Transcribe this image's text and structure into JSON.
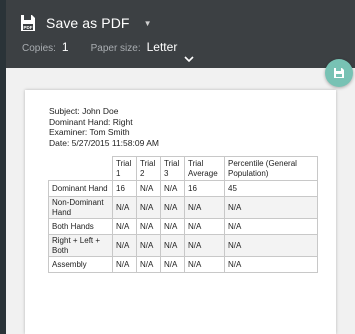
{
  "destination": {
    "label": "Save as PDF",
    "icon": "pdf-save-icon"
  },
  "options": {
    "copies_label": "Copies:",
    "copies_value": "1",
    "paper_size_label": "Paper size:",
    "paper_size_value": "Letter"
  },
  "fab": {
    "icon": "save-icon",
    "color": "#78c2b4"
  },
  "colors": {
    "toolbar": "#3c4043",
    "page_bg": "#f1f1f1"
  },
  "document": {
    "subject": "Subject: John Doe",
    "dominant_hand": "Dominant Hand: Right",
    "examiner": "Examiner: Tom Smith",
    "date": "Date: 5/27/2015 11:58:09 AM",
    "table": {
      "headers": [
        "",
        "Trial 1",
        "Trial 2",
        "Trial 3",
        "Trial Average",
        "Percentile (General Population)"
      ],
      "rows": [
        [
          "Dominant Hand",
          "16",
          "N/A",
          "N/A",
          "16",
          "45"
        ],
        [
          "Non-Dominant Hand",
          "N/A",
          "N/A",
          "N/A",
          "N/A",
          "N/A"
        ],
        [
          "Both Hands",
          "N/A",
          "N/A",
          "N/A",
          "N/A",
          "N/A"
        ],
        [
          "Right + Left + Both",
          "N/A",
          "N/A",
          "N/A",
          "N/A",
          "N/A"
        ],
        [
          "Assembly",
          "N/A",
          "N/A",
          "N/A",
          "N/A",
          "N/A"
        ]
      ]
    }
  }
}
